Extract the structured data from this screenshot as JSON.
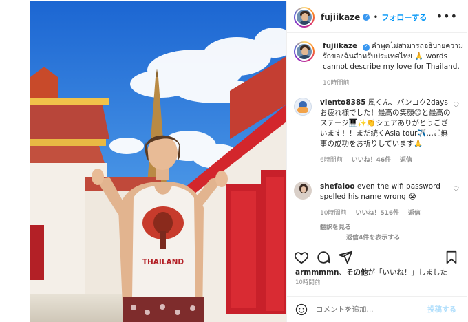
{
  "post": {
    "username": "fujiikaze",
    "follow_label": "フォローする",
    "more_label": "•••",
    "caption_user": "fujiikaze",
    "caption_text": "คำพูดไม่สามารถอธิบายความรักของฉันสำหรับประเทศไทย 🙏 words cannot describe my love for Thailand.",
    "caption_time": "10時間前",
    "shirt_text": "THAILAND"
  },
  "comments": [
    {
      "username": "viento8385",
      "text": "風くん、バンコク2days お疲れ様でした！最高の笑顔😊と最高のステージ🎹✨👏シェアありがとうございます！！まだ続くAsia tour✈️…ご無事の成功をお祈りしています🙏",
      "time": "6時間前",
      "likes": "いいね！46件",
      "reply": "返信"
    },
    {
      "username": "shefaloo",
      "text": "even the wifi password spelled his name wrong 😭",
      "time": "10時間前",
      "likes": "いいね！516件",
      "reply": "返信",
      "translate": "翻訳を見る"
    }
  ],
  "view_replies": "返信4件を表示する",
  "likes_summary": {
    "user": "armmmmn",
    "others": "その他",
    "rest": "が「いいね！」しました"
  },
  "post_time": "10時間前",
  "comment_box": {
    "placeholder": "コメントを追加...",
    "post_label": "投稿する"
  },
  "icons": {
    "heart": "heart-icon",
    "comment": "comment-icon",
    "share": "share-icon",
    "save": "bookmark-icon",
    "emoji": "emoji-icon",
    "next": "chevron-right-icon"
  },
  "colors": {
    "follow": "#0095f6",
    "verified": "#3897f0",
    "sky_top": "#1f6fd6",
    "temple_red": "#c8202a"
  }
}
